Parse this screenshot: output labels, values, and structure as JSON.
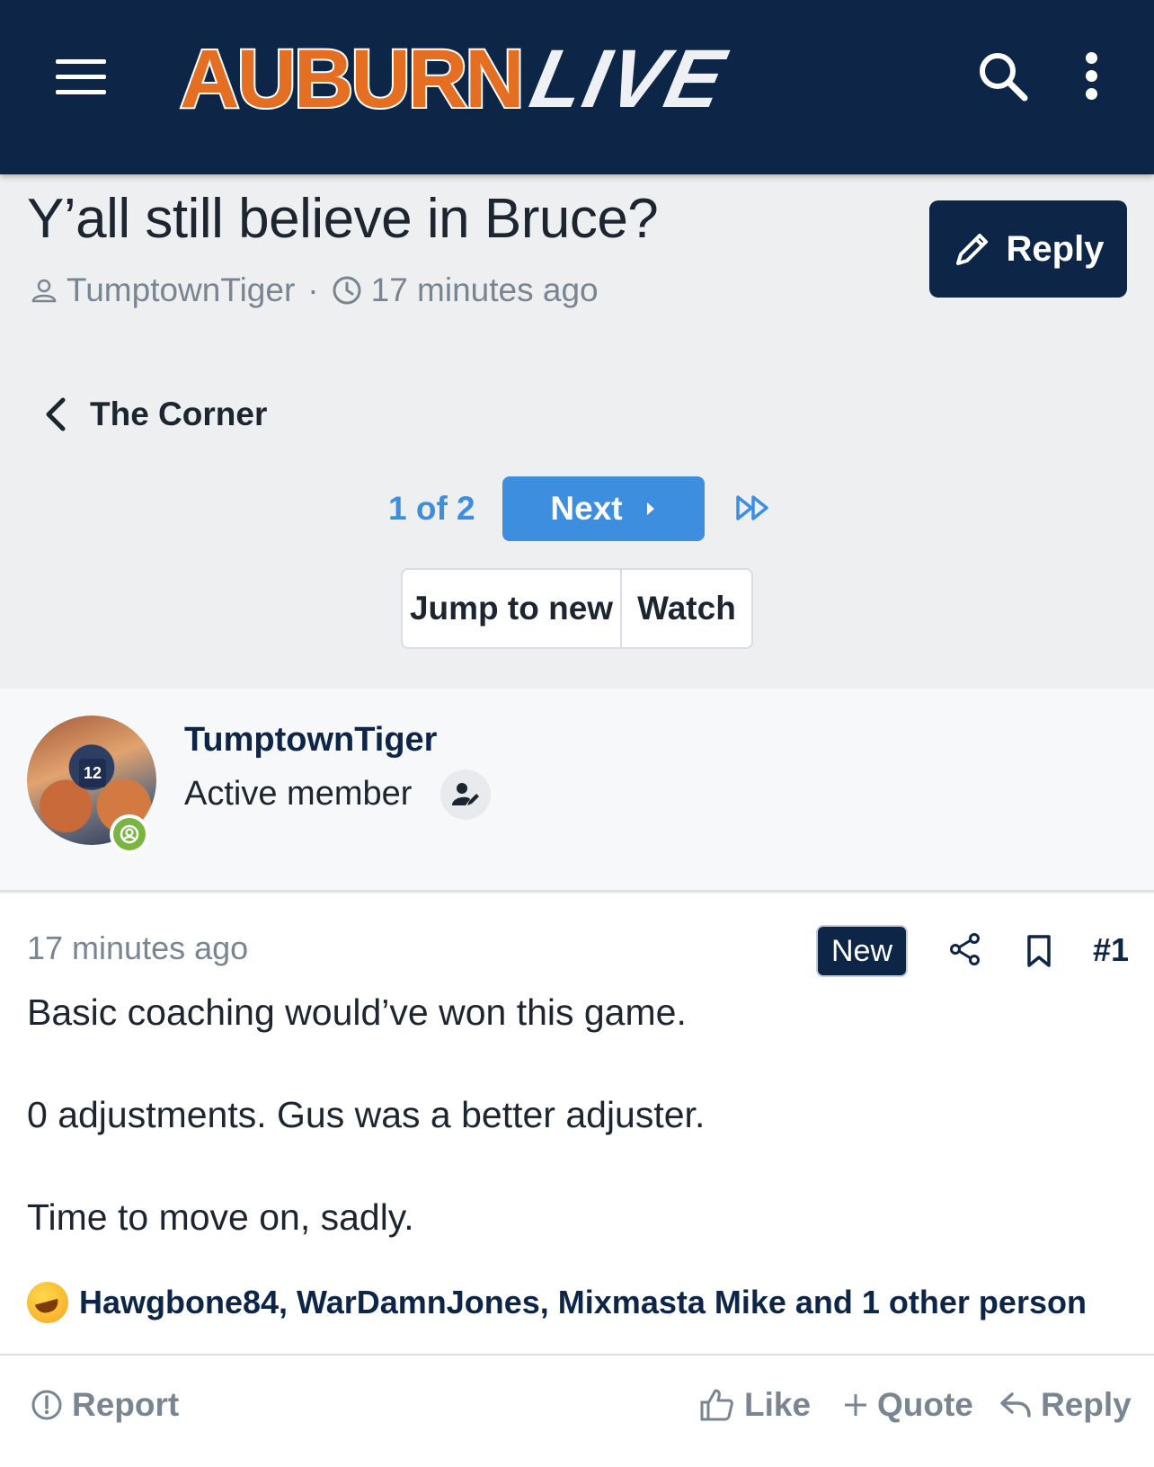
{
  "header": {
    "logo_primary": "AUBURN",
    "logo_secondary": "LIVE",
    "brand_colors": {
      "navy": "#0d2547",
      "orange": "#e46f23",
      "blue": "#3e8ee0"
    }
  },
  "thread": {
    "title": "Y’all still believe in Bruce?",
    "author": "TumptownTiger",
    "time": "17 minutes ago",
    "reply_label": "Reply"
  },
  "breadcrumb": {
    "label": "The Corner"
  },
  "pagination": {
    "label": "1 of 2",
    "next_label": "Next"
  },
  "thread_actions": {
    "jump_label": "Jump to new",
    "watch_label": "Watch"
  },
  "post": {
    "username": "TumptownTiger",
    "role": "Active member",
    "avatar_jersey": "12",
    "time": "17 minutes ago",
    "new_badge": "New",
    "number": "#1",
    "paragraphs": [
      "Basic coaching would’ve won this game.",
      "0 adjustments. Gus was a better adjuster.",
      "Time to move on, sadly."
    ],
    "reactions_text": "Hawgbone84, WarDamnJones, Mixmasta Mike and 1 other person",
    "reaction_icon": "rofl-emoji",
    "actions": {
      "report": "Report",
      "like": "Like",
      "quote": "Quote",
      "reply": "Reply"
    }
  }
}
